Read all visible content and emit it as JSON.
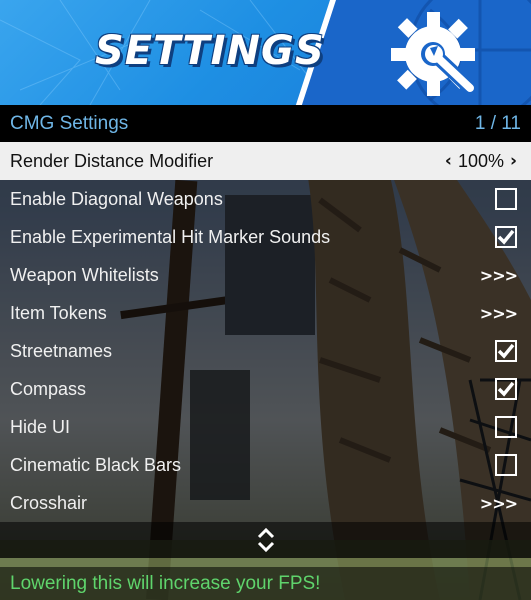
{
  "banner": {
    "title": "SETTINGS",
    "icon": "gear-wrench-icon",
    "color_left": "#2a9bec",
    "color_right": "#1a66c9"
  },
  "menu": {
    "title": "CMG Settings",
    "page_counter": "1 / 11",
    "title_color": "#6fb6e6",
    "items": [
      {
        "label": "Render Distance Modifier",
        "type": "selector",
        "value": "100%",
        "selected": true
      },
      {
        "label": "Enable Diagonal Weapons",
        "type": "checkbox",
        "checked": false
      },
      {
        "label": "Enable Experimental Hit Marker Sounds",
        "type": "checkbox",
        "checked": true
      },
      {
        "label": "Weapon Whitelists",
        "type": "submenu",
        "indicator": ">>>"
      },
      {
        "label": "Item Tokens",
        "type": "submenu",
        "indicator": ">>>"
      },
      {
        "label": "Streetnames",
        "type": "checkbox",
        "checked": true
      },
      {
        "label": "Compass",
        "type": "checkbox",
        "checked": true
      },
      {
        "label": "Hide UI",
        "type": "checkbox",
        "checked": false
      },
      {
        "label": "Cinematic Black Bars",
        "type": "checkbox",
        "checked": false
      },
      {
        "label": "Crosshair",
        "type": "submenu",
        "indicator": ">>>"
      }
    ],
    "selector_left": "‹",
    "selector_right": "›"
  },
  "scroll_icon": "up-down-arrows-icon",
  "description": {
    "text": "Lowering this will increase your FPS!",
    "color": "#5fd46c"
  }
}
